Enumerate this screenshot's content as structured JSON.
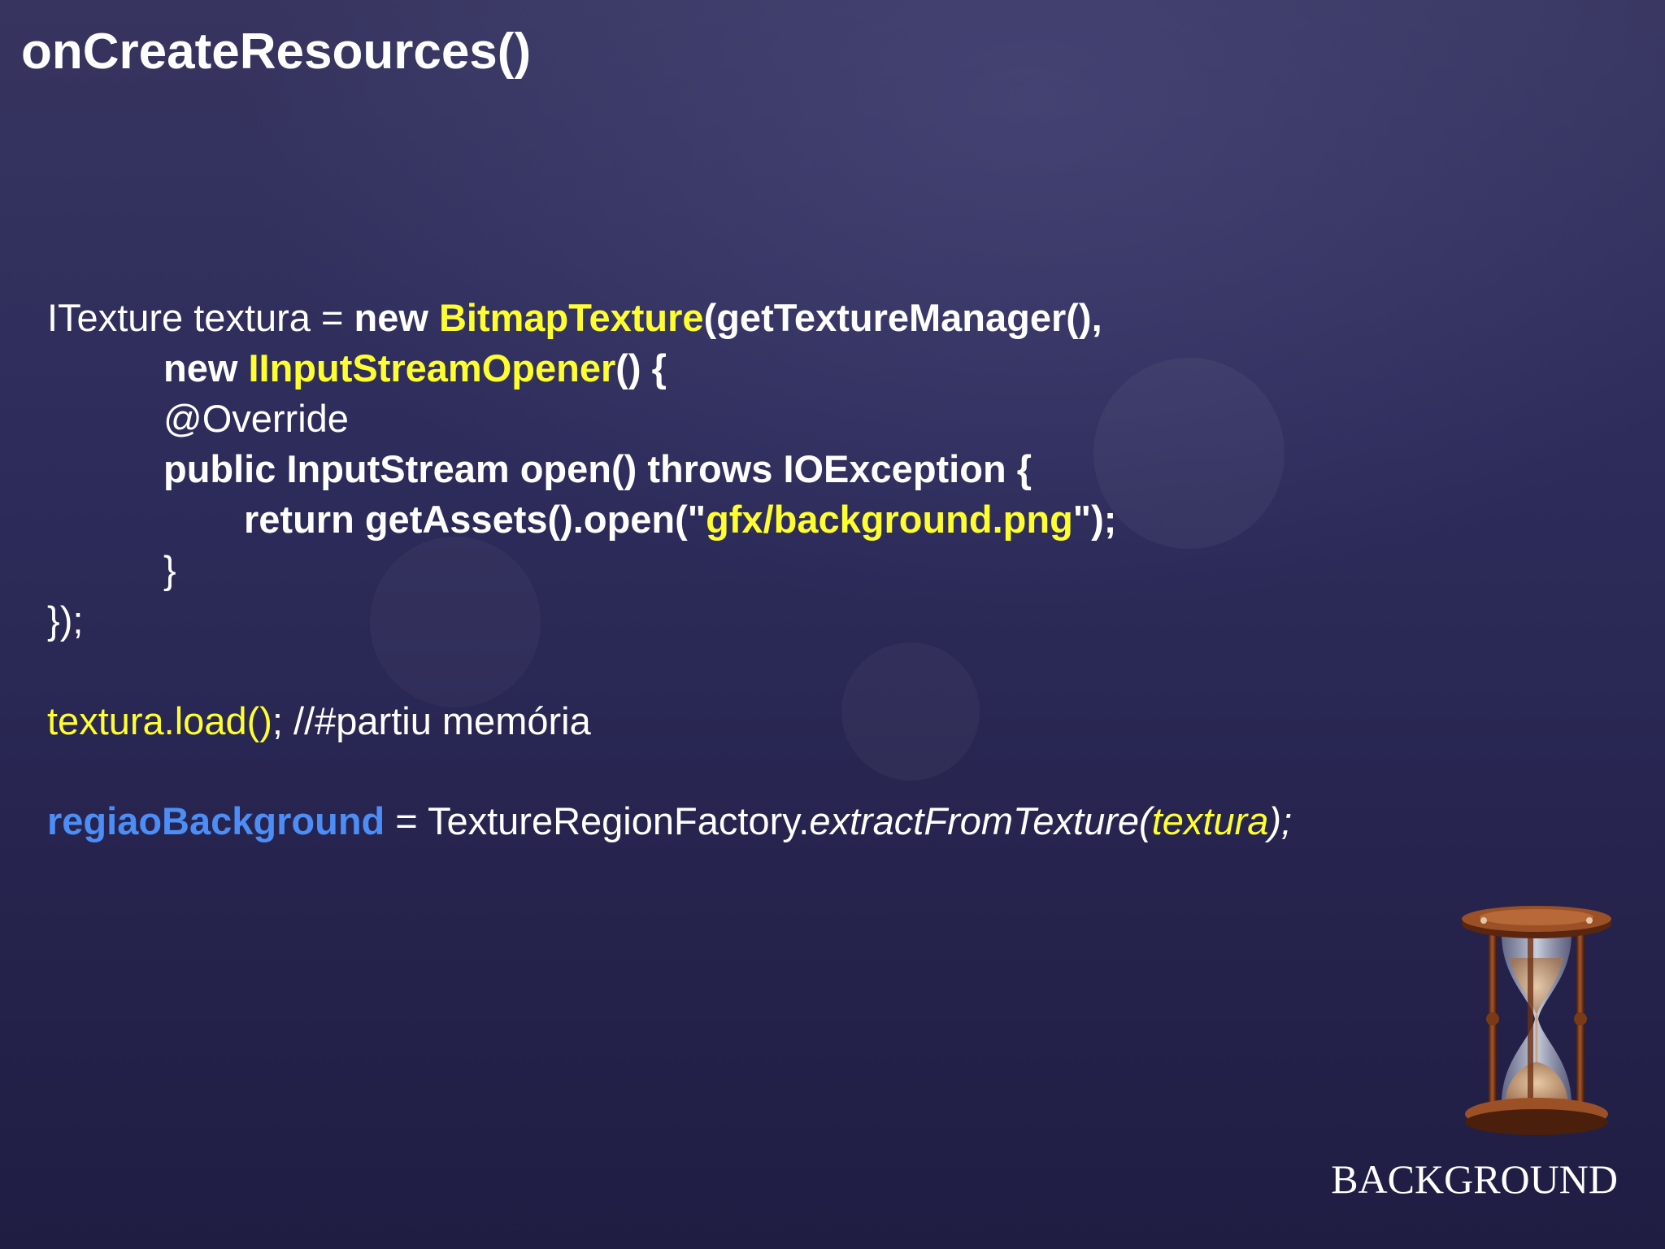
{
  "slide": {
    "title": "onCreateResources()",
    "section_label": "BACKGROUND"
  },
  "code": {
    "l1": {
      "a": "ITexture textura = ",
      "b": "new ",
      "c": "BitmapTexture",
      "d": "(getTextureManager(),"
    },
    "l2": {
      "a": "new ",
      "b": "IInputStreamOpener",
      "c": "() {"
    },
    "l3": "@Override",
    "l4": "public InputStream open() throws IOException {",
    "l5": {
      "a": "return getAssets().open(\"",
      "b": "gfx/background.png",
      "c": "\");"
    },
    "l6": "}",
    "l7": "});",
    "l8": {
      "a": "textura.load()",
      "b": "; //#partiu memória"
    },
    "l9": {
      "a": "regiaoBackground",
      "b": " = TextureRegionFactory.",
      "c": "extractFromTexture(",
      "d": "textura",
      "e": ");"
    }
  },
  "colors": {
    "background": "#2e2c5b",
    "text": "#ffffff",
    "highlight_yellow": "#ffff2e",
    "highlight_blue": "#4c8df6"
  },
  "icons": {
    "decoration": "hourglass-icon"
  }
}
